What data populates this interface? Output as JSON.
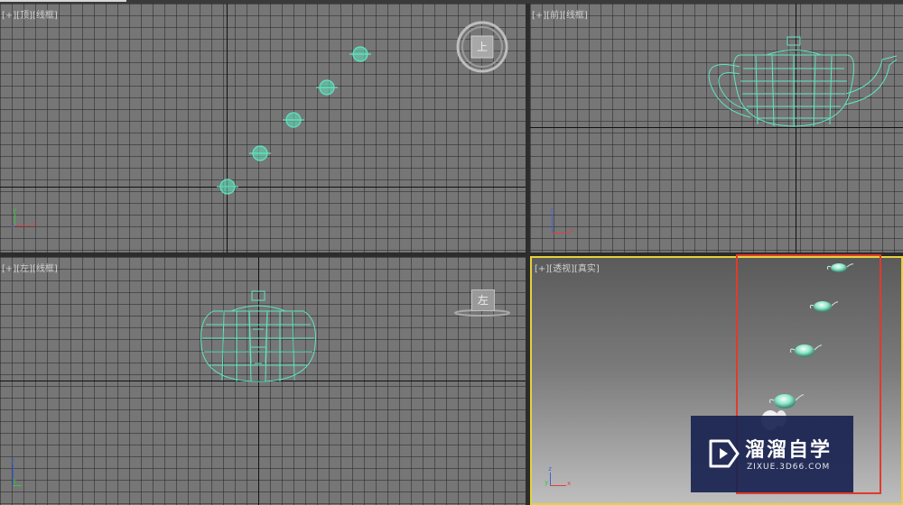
{
  "viewports": {
    "top": {
      "label_prefix": "[+][",
      "view": "顶",
      "mid": "][",
      "mode": "线框",
      "suffix": "]",
      "viewcube": "上"
    },
    "front": {
      "label_prefix": "[+][",
      "view": "前",
      "mid": "][",
      "mode": "线框",
      "suffix": "]"
    },
    "left": {
      "label_prefix": "[+][",
      "view": "左",
      "mid": "][",
      "mode": "线框",
      "suffix": "]",
      "viewcube": "左"
    },
    "perspective": {
      "label_prefix": "[+][",
      "view": "透视",
      "mid": "][",
      "mode": "真实",
      "suffix": "]"
    }
  },
  "gizmo": {
    "x": "x",
    "y": "y",
    "z": "z"
  },
  "colors": {
    "wireframe": "#5ee6c0",
    "active_border": "#e6d23a",
    "highlight": "#e23a2a",
    "watermark_bg": "#19234f"
  },
  "watermark": {
    "title": "溜溜自学",
    "url": "ZIXUE.3D66.COM",
    "icon": "play-logo-icon"
  }
}
